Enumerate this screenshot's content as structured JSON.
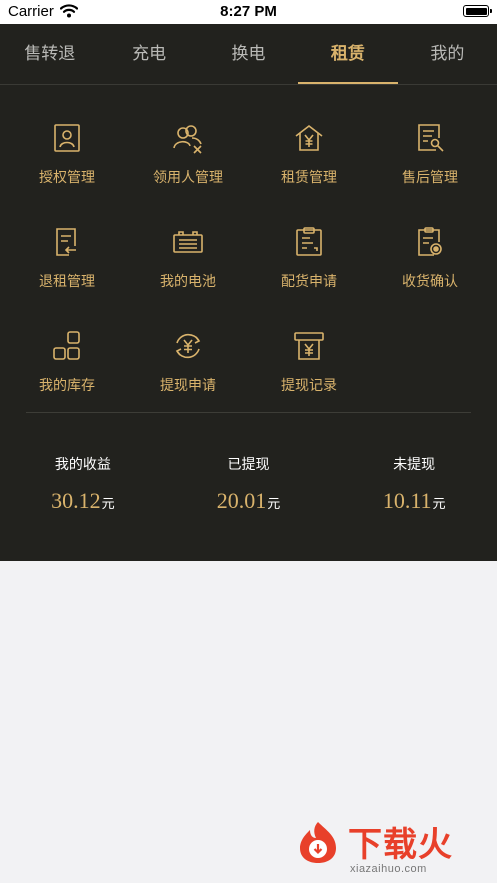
{
  "status_bar": {
    "carrier": "Carrier",
    "time": "8:27 PM"
  },
  "tabs": [
    {
      "label": "售转退",
      "active": false
    },
    {
      "label": "充电",
      "active": false
    },
    {
      "label": "换电",
      "active": false
    },
    {
      "label": "租赁",
      "active": true
    },
    {
      "label": "我的",
      "active": false
    }
  ],
  "grid": {
    "items": [
      {
        "label": "授权管理",
        "icon": "authorization-icon"
      },
      {
        "label": "领用人管理",
        "icon": "users-manage-icon"
      },
      {
        "label": "租赁管理",
        "icon": "rental-house-yen-icon"
      },
      {
        "label": "售后管理",
        "icon": "after-sales-doc-icon"
      },
      {
        "label": "退租管理",
        "icon": "return-rent-doc-icon"
      },
      {
        "label": "我的电池",
        "icon": "battery-icon"
      },
      {
        "label": "配货申请",
        "icon": "distribution-clipboard-icon"
      },
      {
        "label": "收货确认",
        "icon": "receipt-confirm-icon"
      },
      {
        "label": "我的库存",
        "icon": "inventory-blocks-icon"
      },
      {
        "label": "提现申请",
        "icon": "withdraw-yen-cycle-icon"
      },
      {
        "label": "提现记录",
        "icon": "withdraw-record-icon"
      }
    ]
  },
  "stats": {
    "earnings": {
      "title": "我的收益",
      "value": "30.12",
      "unit": "元"
    },
    "withdrawn": {
      "title": "已提现",
      "value": "20.01",
      "unit": "元"
    },
    "not_withdrawn": {
      "title": "未提现",
      "value": "10.11",
      "unit": "元"
    }
  },
  "watermark": {
    "brand": "下载火",
    "url": "xiazaihuo.com"
  },
  "colors": {
    "accent": "#d9b36c",
    "panel": "#22221e",
    "page": "#f2f2f4"
  }
}
